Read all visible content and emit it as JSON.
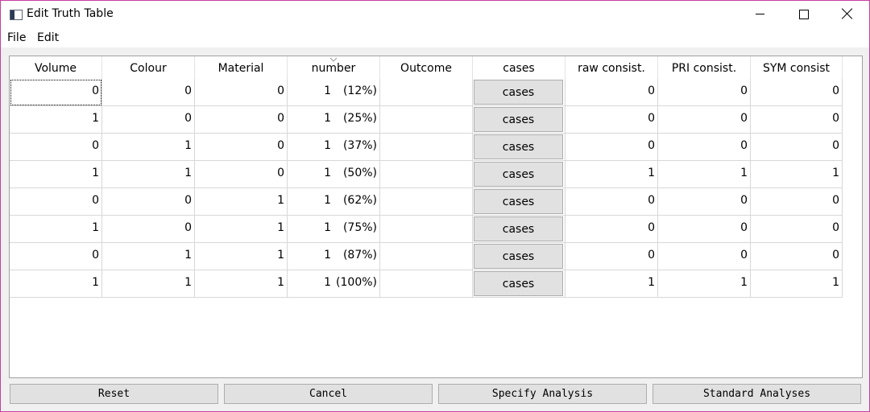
{
  "window": {
    "title": "Edit Truth Table"
  },
  "menu": {
    "file": "File",
    "edit": "Edit"
  },
  "table": {
    "columns": [
      "Volume",
      "Colour",
      "Material",
      "number",
      "Outcome",
      "cases",
      "raw consist.",
      "PRI consist.",
      "SYM consist"
    ],
    "rows": [
      {
        "volume": "0",
        "colour": "0",
        "material": "0",
        "number": "1",
        "number_pct": "(12%)",
        "outcome": "",
        "cases": "cases",
        "raw": "0",
        "pri": "0",
        "sym": "0"
      },
      {
        "volume": "1",
        "colour": "0",
        "material": "0",
        "number": "1",
        "number_pct": "(25%)",
        "outcome": "",
        "cases": "cases",
        "raw": "0",
        "pri": "0",
        "sym": "0"
      },
      {
        "volume": "0",
        "colour": "1",
        "material": "0",
        "number": "1",
        "number_pct": "(37%)",
        "outcome": "",
        "cases": "cases",
        "raw": "0",
        "pri": "0",
        "sym": "0"
      },
      {
        "volume": "1",
        "colour": "1",
        "material": "0",
        "number": "1",
        "number_pct": "(50%)",
        "outcome": "",
        "cases": "cases",
        "raw": "1",
        "pri": "1",
        "sym": "1"
      },
      {
        "volume": "0",
        "colour": "0",
        "material": "1",
        "number": "1",
        "number_pct": "(62%)",
        "outcome": "",
        "cases": "cases",
        "raw": "0",
        "pri": "0",
        "sym": "0"
      },
      {
        "volume": "1",
        "colour": "0",
        "material": "1",
        "number": "1",
        "number_pct": "(75%)",
        "outcome": "",
        "cases": "cases",
        "raw": "0",
        "pri": "0",
        "sym": "0"
      },
      {
        "volume": "0",
        "colour": "1",
        "material": "1",
        "number": "1",
        "number_pct": "(87%)",
        "outcome": "",
        "cases": "cases",
        "raw": "0",
        "pri": "0",
        "sym": "0"
      },
      {
        "volume": "1",
        "colour": "1",
        "material": "1",
        "number": "1",
        "number_pct": "(100%)",
        "outcome": "",
        "cases": "cases",
        "raw": "1",
        "pri": "1",
        "sym": "1"
      }
    ]
  },
  "buttons": {
    "reset": "Reset",
    "cancel": "Cancel",
    "specify": "Specify Analysis",
    "standard": "Standard Analyses"
  },
  "colors": {
    "window_border": "#c83ea0",
    "button_face": "#e1e1e1",
    "grid_line": "#d8d8d8"
  }
}
